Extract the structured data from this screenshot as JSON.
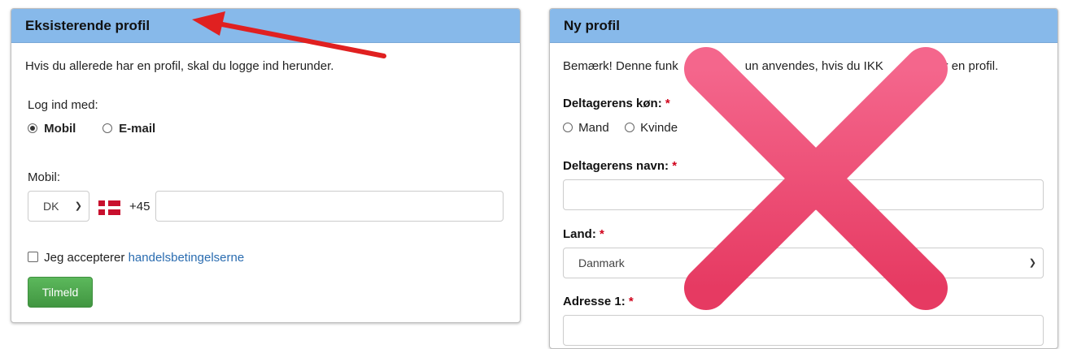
{
  "left": {
    "title": "Eksisterende profil",
    "intro": "Hvis du allerede har en profil, skal du logge ind herunder.",
    "login_with": "Log ind med:",
    "options": [
      "Mobil",
      "E-mail"
    ],
    "selected_option": "Mobil",
    "mobile_label": "Mobil:",
    "country_code": "DK",
    "dial_code": "+45",
    "mobile_value": "",
    "terms_prefix": "Jeg accepterer",
    "terms_link": "handelsbetingelserne",
    "submit": "Tilmeld"
  },
  "right": {
    "title": "Ny profil",
    "notice": "Bemærk! Denne funk",
    "notice_mid": "un anvendes, hvis du IKK",
    "notice_end": "har en profil.",
    "gender_label": "Deltagerens køn:",
    "gender_options": [
      "Mand",
      "Kvinde"
    ],
    "name_label": "Deltagerens navn:",
    "name_value": "",
    "country_label": "Land:",
    "country_value": "Danmark",
    "address_label": "Adresse 1:",
    "required_mark": "*"
  },
  "colors": {
    "panel_header": "#87b9ea",
    "arrow": "#e02020",
    "cross": "#ee4d72",
    "button": "#4cae4c",
    "link": "#2a6cb0"
  },
  "icons": [
    "danish-flag-icon",
    "arrow-annotation",
    "red-x-annotation"
  ]
}
